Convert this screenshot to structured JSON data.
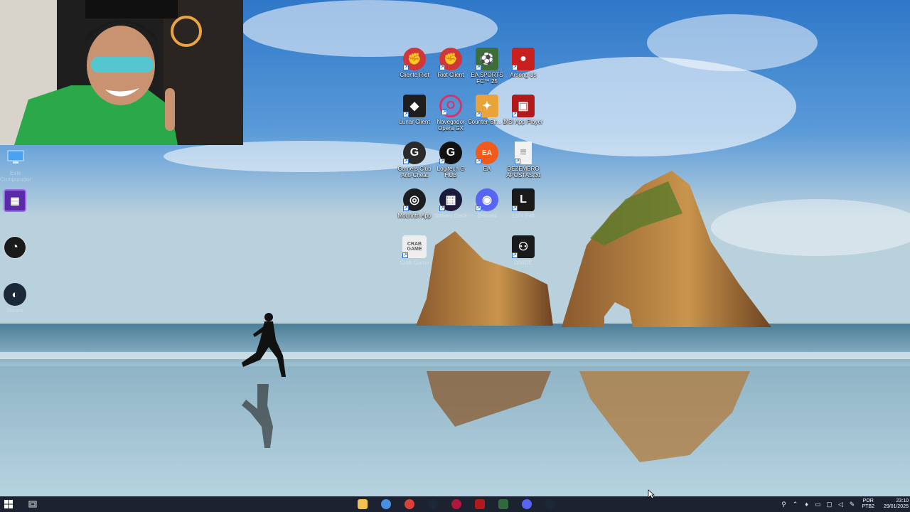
{
  "desktop": {
    "icons_left": [
      {
        "label": "Este Computador",
        "icon": "computer-icon",
        "color": "#4aa3f0"
      },
      {
        "label": "",
        "icon": "app-purple-icon",
        "color": "#5b2aa8"
      },
      {
        "label": "",
        "icon": "obs-icon",
        "color": "#1a1a1a"
      },
      {
        "label": "Steam",
        "icon": "steam-icon",
        "color": "#1b2838"
      }
    ],
    "icons_grid": [
      {
        "label": "Cliente Riot",
        "icon": "riot-client-icon",
        "color": "#d13639",
        "glyph": "✊"
      },
      {
        "label": "Riot Client",
        "icon": "riot-client-icon",
        "color": "#d13639",
        "glyph": "✊"
      },
      {
        "label": "EA SPORTS FC™ 25",
        "icon": "ea-fc-icon",
        "color": "#3d6e3a",
        "glyph": "⚽"
      },
      {
        "label": "Among Us",
        "icon": "among-us-icon",
        "color": "#c81f1f",
        "glyph": "●"
      },
      {
        "label": "Lunar Client",
        "icon": "lunar-client-icon",
        "color": "#1e1e1e",
        "glyph": "◆"
      },
      {
        "label": "Navegador Opera GX",
        "icon": "opera-gx-icon",
        "color": "#ffffff",
        "glyph": "O"
      },
      {
        "label": "Counter-Str... 2",
        "icon": "counter-strike-icon",
        "color": "#e8a33a",
        "glyph": "✦"
      },
      {
        "label": "MSI App Player",
        "icon": "msi-app-player-icon",
        "color": "#b01a1a",
        "glyph": "▣"
      },
      {
        "label": "Gamers Club Anti-Cheat",
        "icon": "gamers-club-icon",
        "color": "#2b2b2b",
        "glyph": "G"
      },
      {
        "label": "Logitech G HUB",
        "icon": "logitech-g-hub-icon",
        "color": "#111111",
        "glyph": "G"
      },
      {
        "label": "EA",
        "icon": "ea-icon",
        "color": "#f25a1c",
        "glyph": "EA"
      },
      {
        "label": "DEZEMBRO APOSTAS.txt",
        "icon": "text-file-icon",
        "color": "#f2f2f2",
        "glyph": "≡"
      },
      {
        "label": "Modrinth App",
        "icon": "modrinth-icon",
        "color": "#1b1d20",
        "glyph": "◎"
      },
      {
        "label": "Stream Deck",
        "icon": "stream-deck-icon",
        "color": "#1a1a3a",
        "glyph": "▦"
      },
      {
        "label": "Discord",
        "icon": "discord-icon",
        "color": "#5865f2",
        "glyph": "◉"
      },
      {
        "label": "Lol's Fall",
        "icon": "lol-fall-icon",
        "color": "#1a1a1a",
        "glyph": "L"
      },
      {
        "label": "Crab Game",
        "icon": "crab-game-icon",
        "color": "#eeeeee",
        "glyph": "CRAB GAME"
      },
      {
        "label": "",
        "icon": "empty-slot",
        "color": "",
        "glyph": ""
      },
      {
        "label": "",
        "icon": "empty-slot",
        "color": "",
        "glyph": ""
      },
      {
        "label": "DiViDE",
        "icon": "divide-icon",
        "color": "#1a1a1a",
        "glyph": "⚇"
      }
    ]
  },
  "taskbar": {
    "pinned": [
      {
        "name": "file-explorer-icon",
        "color": "#f2c14e"
      },
      {
        "name": "chrome-icon",
        "color": "#4a90e2"
      },
      {
        "name": "gamers-club-taskbar-icon",
        "color": "#d9413a"
      },
      {
        "name": "steam-taskbar-icon",
        "color": "#1b2838"
      },
      {
        "name": "opera-gx-taskbar-icon",
        "color": "#b0173c"
      },
      {
        "name": "msi-taskbar-icon",
        "color": "#b01a1a"
      },
      {
        "name": "excel-taskbar-icon",
        "color": "#2f6b3a"
      },
      {
        "name": "discord-taskbar-icon",
        "color": "#5865f2"
      },
      {
        "name": "steam-taskbar-icon-2",
        "color": "#1b2838"
      }
    ],
    "tray": {
      "language_line1": "POR",
      "language_line2": "PTB2",
      "time": "23:10",
      "date": "29/01/2025"
    }
  }
}
